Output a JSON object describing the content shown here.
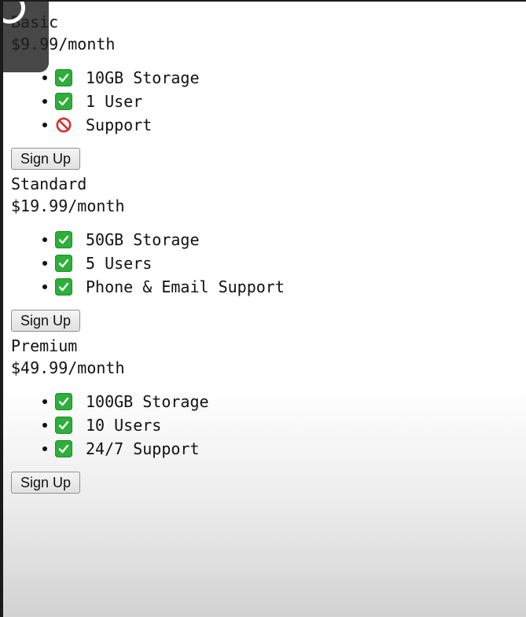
{
  "plans": [
    {
      "name": "Basic",
      "price": "$9.99/month",
      "features": [
        {
          "status": "check-icon",
          "text": "10GB Storage"
        },
        {
          "status": "check-icon",
          "text": "1 User"
        },
        {
          "status": "no-entry-icon",
          "text": "Support"
        }
      ],
      "button": "Sign Up"
    },
    {
      "name": "Standard",
      "price": "$19.99/month",
      "features": [
        {
          "status": "check-icon",
          "text": "50GB Storage"
        },
        {
          "status": "check-icon",
          "text": "5 Users"
        },
        {
          "status": "check-icon",
          "text": "Phone & Email Support"
        }
      ],
      "button": "Sign Up"
    },
    {
      "name": "Premium",
      "price": "$49.99/month",
      "features": [
        {
          "status": "check-icon",
          "text": "100GB Storage"
        },
        {
          "status": "check-icon",
          "text": "10 Users"
        },
        {
          "status": "check-icon",
          "text": "24/7 Support"
        }
      ],
      "button": "Sign Up"
    }
  ],
  "colors": {
    "check": "#2eae3a",
    "no_entry": "#d6312f"
  }
}
